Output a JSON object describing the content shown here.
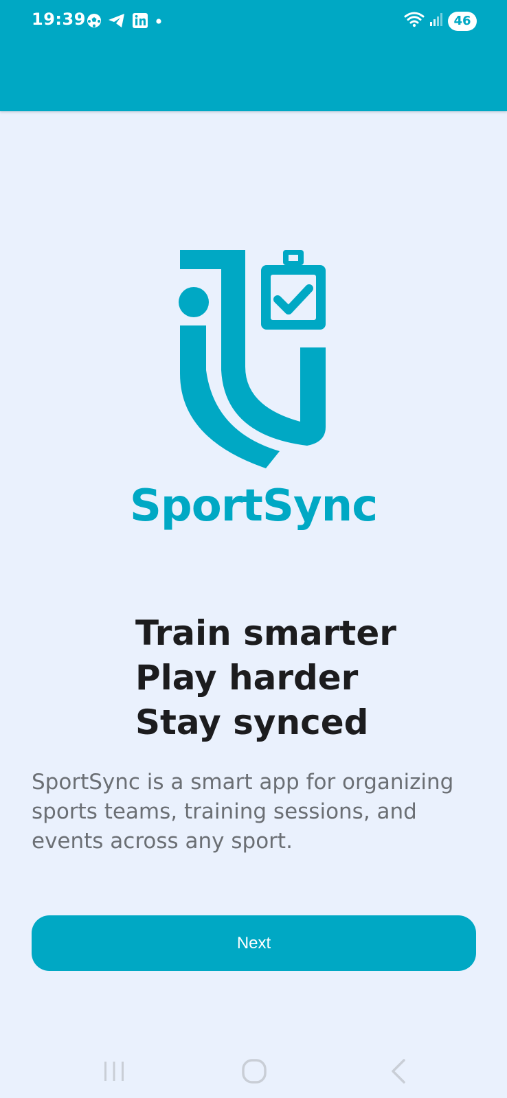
{
  "status_bar": {
    "time": "19:39",
    "left_icons": [
      "soccer-ball-icon",
      "telegram-icon",
      "linkedin-icon",
      "dot-icon"
    ],
    "right_icons": [
      "wifi-icon",
      "signal-icon"
    ],
    "battery": "46"
  },
  "brand": {
    "name": "SportSync",
    "accent_color": "#00a8c4"
  },
  "tagline": {
    "line1": "Train smarter",
    "line2": "Play harder",
    "line3": "Stay synced"
  },
  "description": "SportSync is a smart app for organizing sports teams, training sessions, and events across any sport.",
  "actions": {
    "next_label": "Next"
  },
  "navigation": {
    "buttons": [
      "recent-apps-icon",
      "home-icon",
      "back-icon"
    ]
  }
}
